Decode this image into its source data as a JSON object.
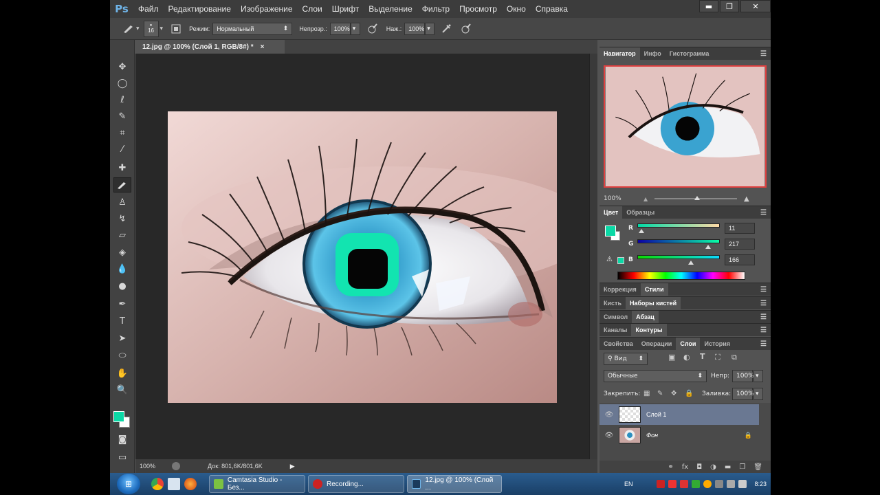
{
  "app": {
    "logo": "Ps"
  },
  "menu": [
    "Файл",
    "Редактирование",
    "Изображение",
    "Слои",
    "Шрифт",
    "Выделение",
    "Фильтр",
    "Просмотр",
    "Окно",
    "Справка"
  ],
  "window_controls": {
    "minimize": "▬",
    "restore": "❐",
    "close": "✕"
  },
  "options": {
    "brush_size": "16",
    "mode_label": "Режим:",
    "mode_value": "Нормальный",
    "opacity_label": "Непрозр.:",
    "opacity_value": "100%",
    "pressure_label": "Наж.:",
    "pressure_value": "100%"
  },
  "document": {
    "tab_title": "12.jpg @ 100% (Слой 1, RGB/8#) *",
    "tab_close": "×",
    "zoom": "100%",
    "doc_size": "Док: 801,6K/801,6K"
  },
  "navigator": {
    "tabs": [
      "Навигатор",
      "Инфо",
      "Гистограмма"
    ],
    "zoom": "100%"
  },
  "color_panel": {
    "tabs": [
      "Цвет",
      "Образцы"
    ],
    "channels": [
      {
        "label": "R",
        "value": "11"
      },
      {
        "label": "G",
        "value": "217"
      },
      {
        "label": "B",
        "value": "166"
      }
    ],
    "fg_color": "#0bd9a6"
  },
  "panel_groups": [
    {
      "tabs": [
        "Коррекция",
        "Стили"
      ],
      "active": 1
    },
    {
      "tabs": [
        "Кисть",
        "Наборы кистей"
      ],
      "active": 1
    },
    {
      "tabs": [
        "Символ",
        "Абзац"
      ],
      "active": 1
    },
    {
      "tabs": [
        "Каналы",
        "Контуры"
      ],
      "active": 1
    },
    {
      "tabs": [
        "Свойства",
        "Операции",
        "Слои",
        "История"
      ],
      "active": 2
    }
  ],
  "layers": {
    "filter_label": "Вид",
    "blend_mode": "Обычные",
    "opacity_label": "Непр:",
    "opacity_value": "100%",
    "lock_label": "Закрепить:",
    "fill_label": "Заливка:",
    "fill_value": "100%",
    "items": [
      {
        "name": "Слой 1",
        "selected": true
      },
      {
        "name": "Фон",
        "selected": false
      }
    ]
  },
  "taskbar": {
    "tasks": [
      "Camtasia Studio - Без...",
      "Recording...",
      "12.jpg @ 100% (Слой ..."
    ],
    "lang": "EN",
    "clock": "8:23"
  }
}
